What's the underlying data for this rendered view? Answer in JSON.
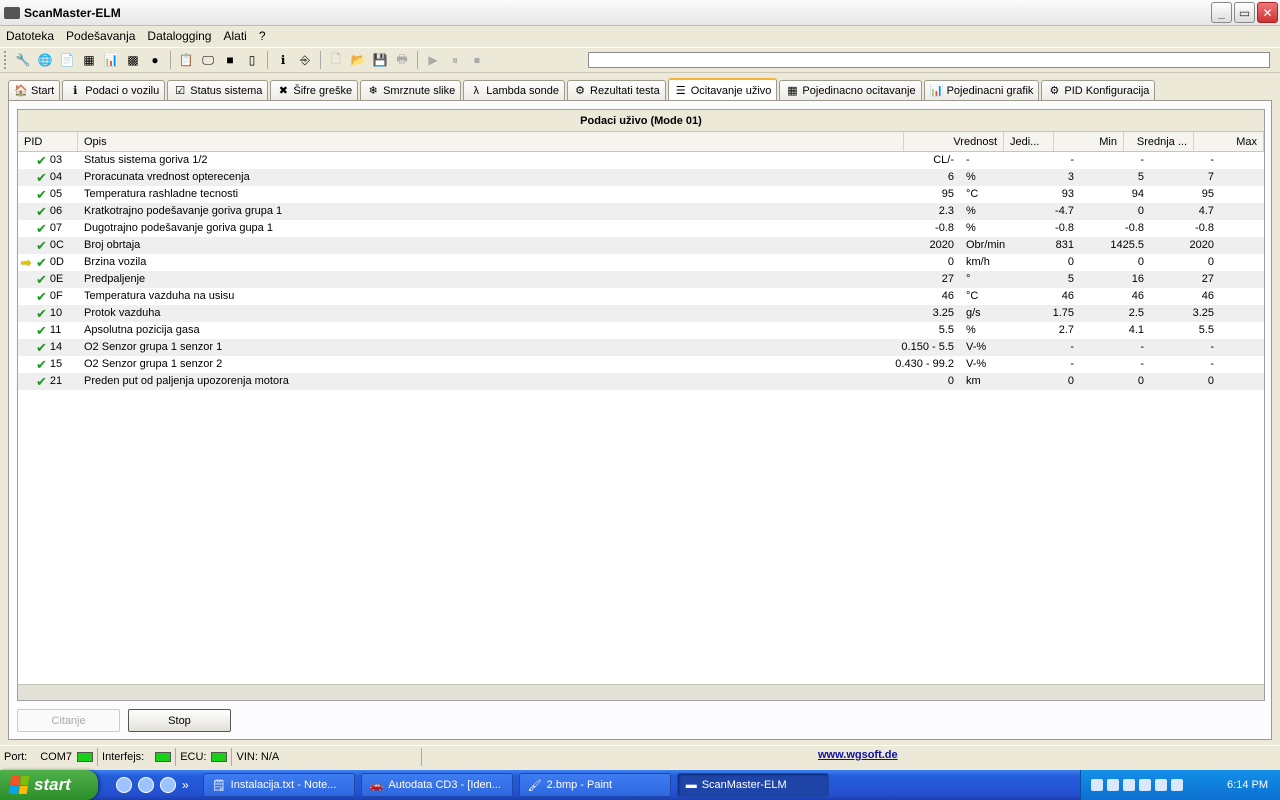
{
  "window": {
    "title": "ScanMaster-ELM"
  },
  "menu": [
    "Datoteka",
    "Podešavanja",
    "Datalogging",
    "Alati",
    "?"
  ],
  "progress": {
    "fraction": 0.0
  },
  "tabs": [
    {
      "label": "Start",
      "icon": "home-icon"
    },
    {
      "label": "Podaci o vozilu",
      "icon": "info-icon"
    },
    {
      "label": "Status sistema",
      "icon": "checklist-icon"
    },
    {
      "label": "Šifre greške",
      "icon": "error-icon"
    },
    {
      "label": "Smrznute slike",
      "icon": "freeze-icon"
    },
    {
      "label": "Lambda sonde",
      "icon": "lambda-icon"
    },
    {
      "label": "Rezultati testa",
      "icon": "gear-icon"
    },
    {
      "label": "Ocitavanje uživo",
      "icon": "list-icon",
      "active": true
    },
    {
      "label": "Pojedinacno ocitavanje",
      "icon": "table-icon"
    },
    {
      "label": "Pojedinacni grafik",
      "icon": "chart-icon"
    },
    {
      "label": "PID Konfiguracija",
      "icon": "config-icon"
    }
  ],
  "grid": {
    "title": "Podaci uživo (Mode 01)",
    "columns": [
      "PID",
      "Opis",
      "Vrednost",
      "Jedi...",
      "Min",
      "Srednja ...",
      "Max"
    ],
    "rows": [
      {
        "pid": "03",
        "desc": "Status sistema goriva 1/2",
        "value": "CL/-",
        "unit": "-",
        "min": "-",
        "avg": "-",
        "max": "-"
      },
      {
        "pid": "04",
        "desc": "Proracunata vrednost opterecenja",
        "value": "6",
        "unit": "%",
        "min": "3",
        "avg": "5",
        "max": "7"
      },
      {
        "pid": "05",
        "desc": "Temperatura rashladne tecnosti",
        "value": "95",
        "unit": "°C",
        "min": "93",
        "avg": "94",
        "max": "95"
      },
      {
        "pid": "06",
        "desc": "Kratkotrajno podešavanje goriva grupa 1",
        "value": "2.3",
        "unit": "%",
        "min": "-4.7",
        "avg": "0",
        "max": "4.7"
      },
      {
        "pid": "07",
        "desc": "Dugotrajno podešavanje goriva gupa 1",
        "value": "-0.8",
        "unit": "%",
        "min": "-0.8",
        "avg": "-0.8",
        "max": "-0.8"
      },
      {
        "pid": "0C",
        "desc": "Broj obrtaja",
        "value": "2020",
        "unit": "Obr/min",
        "min": "831",
        "avg": "1425.5",
        "max": "2020"
      },
      {
        "pid": "0D",
        "desc": "Brzina vozila",
        "value": "0",
        "unit": "km/h",
        "min": "0",
        "avg": "0",
        "max": "0",
        "current": true
      },
      {
        "pid": "0E",
        "desc": "Predpaljenje",
        "value": "27",
        "unit": "°",
        "min": "5",
        "avg": "16",
        "max": "27"
      },
      {
        "pid": "0F",
        "desc": "Temperatura vazduha na usisu",
        "value": "46",
        "unit": "°C",
        "min": "46",
        "avg": "46",
        "max": "46"
      },
      {
        "pid": "10",
        "desc": "Protok vazduha",
        "value": "3.25",
        "unit": "g/s",
        "min": "1.75",
        "avg": "2.5",
        "max": "3.25"
      },
      {
        "pid": "11",
        "desc": "Apsolutna pozicija gasa",
        "value": "5.5",
        "unit": "%",
        "min": "2.7",
        "avg": "4.1",
        "max": "5.5"
      },
      {
        "pid": "14",
        "desc": "O2 Senzor grupa 1 senzor 1",
        "value": "0.150 - 5.5",
        "unit": "V-%",
        "min": "-",
        "avg": "-",
        "max": "-"
      },
      {
        "pid": "15",
        "desc": "O2 Senzor grupa 1 senzor 2",
        "value": "0.430 - 99.2",
        "unit": "V-%",
        "min": "-",
        "avg": "-",
        "max": "-"
      },
      {
        "pid": "21",
        "desc": "Preden put od paljenja upozorenja motora",
        "value": "0",
        "unit": "km",
        "min": "0",
        "avg": "0",
        "max": "0"
      }
    ]
  },
  "buttons": {
    "read": "Citanje",
    "stop": "Stop"
  },
  "status": {
    "port_label": "Port:",
    "port_value": "COM7",
    "interface_label": "Interfejs:",
    "ecu_label": "ECU:",
    "vin": "VIN: N/A",
    "link": "www.wgsoft.de"
  },
  "taskbar": {
    "start": "start",
    "tasks": [
      "Instalacija.txt - Note...",
      "Autodata CD3 - [Iden...",
      "2.bmp - Paint",
      "ScanMaster-ELM"
    ],
    "clock": "6:14 PM"
  },
  "colors": {
    "led": "#18d018",
    "check": "#1a9a1a",
    "accent": "#f2b533"
  }
}
